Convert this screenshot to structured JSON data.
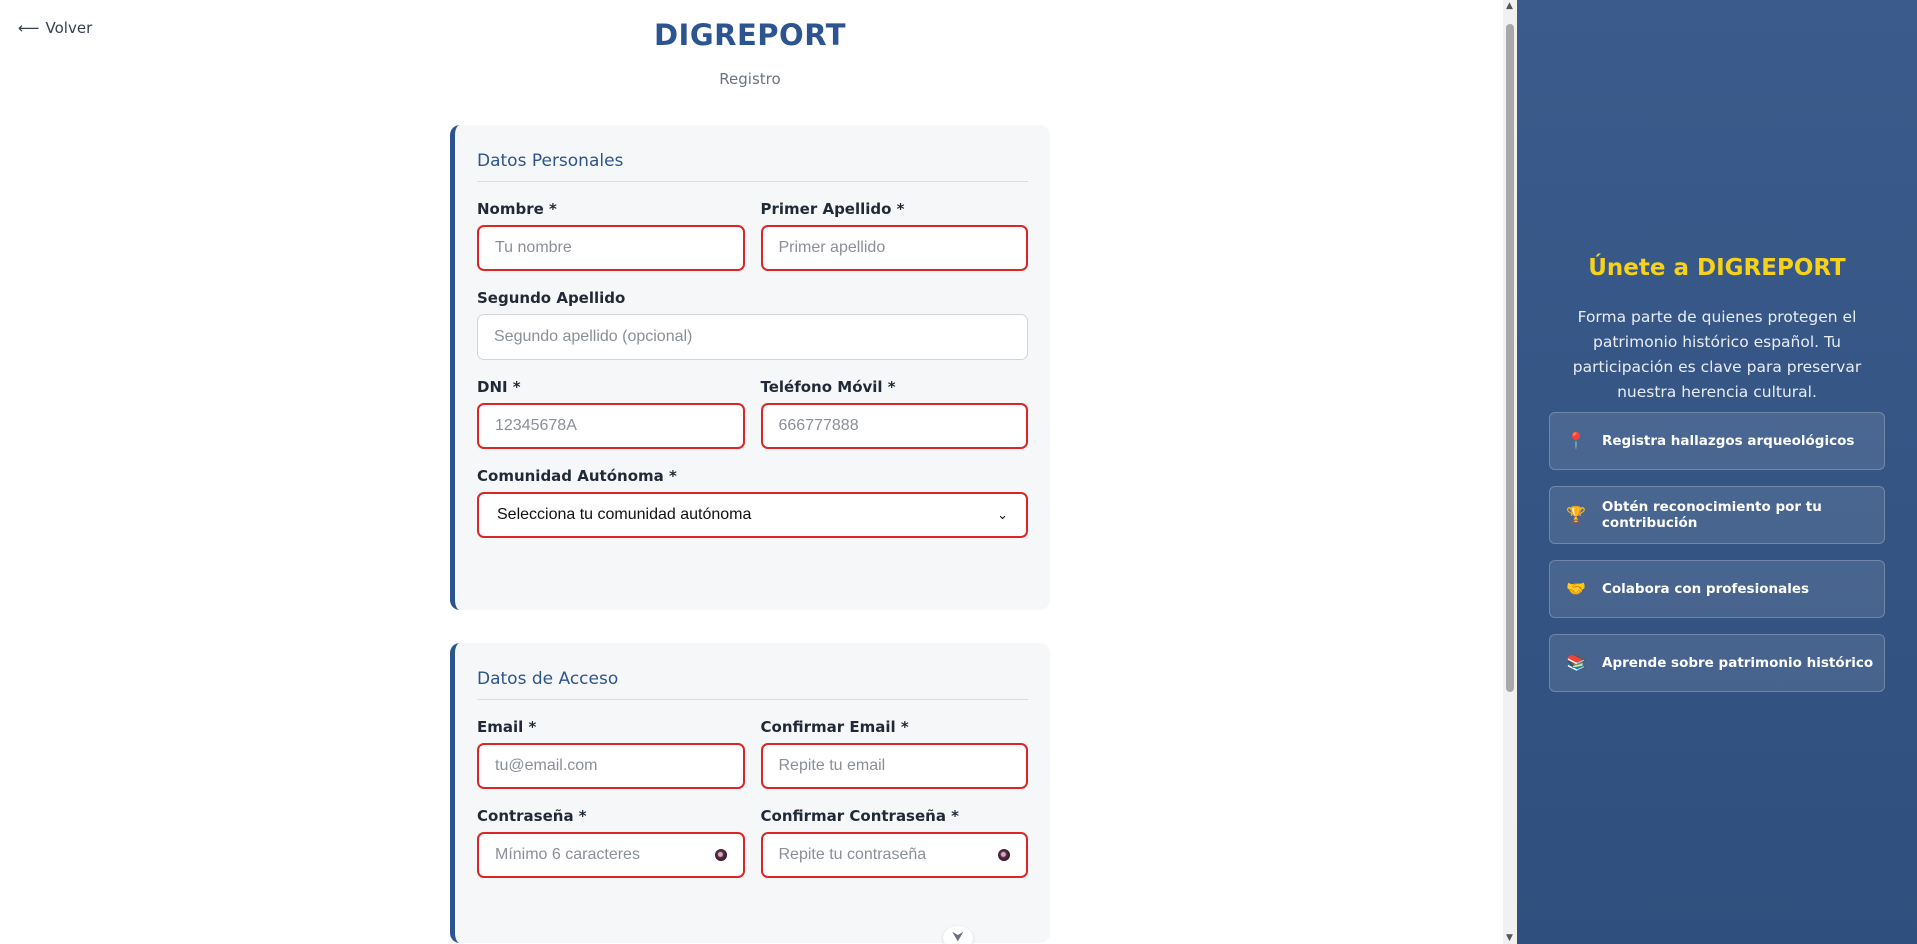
{
  "nav": {
    "back_label": "Volver"
  },
  "header": {
    "brand": "DIGREPORT",
    "subtitle": "Registro"
  },
  "personal": {
    "title": "Datos Personales",
    "nombre": {
      "label": "Nombre *",
      "placeholder": "Tu nombre"
    },
    "apellido1": {
      "label": "Primer Apellido *",
      "placeholder": "Primer apellido"
    },
    "apellido2": {
      "label": "Segundo Apellido",
      "placeholder": "Segundo apellido (opcional)"
    },
    "dni": {
      "label": "DNI *",
      "placeholder": "12345678A"
    },
    "telefono": {
      "label": "Teléfono Móvil *",
      "placeholder": "666777888"
    },
    "comunidad": {
      "label": "Comunidad Autónoma *",
      "selected": "Selecciona tu comunidad autónoma"
    }
  },
  "access": {
    "title": "Datos de Acceso",
    "email": {
      "label": "Email *",
      "placeholder": "tu@email.com"
    },
    "email_confirm": {
      "label": "Confirmar Email *",
      "placeholder": "Repite tu email"
    },
    "password": {
      "label": "Contraseña *",
      "placeholder": "Mínimo 6 caracteres"
    },
    "password_confirm": {
      "label": "Confirmar Contraseña *",
      "placeholder": "Repite tu contraseña"
    }
  },
  "panel": {
    "title": "Únete a DIGREPORT",
    "description": "Forma parte de quienes protegen el patrimonio histórico español. Tu participación es clave para preservar nuestra herencia cultural.",
    "items": [
      {
        "icon": "pin-icon",
        "glyph": "📍",
        "label": "Registra hallazgos arqueológicos"
      },
      {
        "icon": "trophy-icon",
        "glyph": "🏆",
        "label": "Obtén reconocimiento por tu contribución"
      },
      {
        "icon": "handshake-icon",
        "glyph": "🤝",
        "label": "Colabora con profesionales"
      },
      {
        "icon": "books-icon",
        "glyph": "📚",
        "label": "Aprende sobre patrimonio histórico"
      }
    ]
  },
  "colors": {
    "brand": "#2c5490",
    "error_border": "#dc2626",
    "accent_yellow": "#f7d21d",
    "panel_bg": "#3b5b8c"
  }
}
